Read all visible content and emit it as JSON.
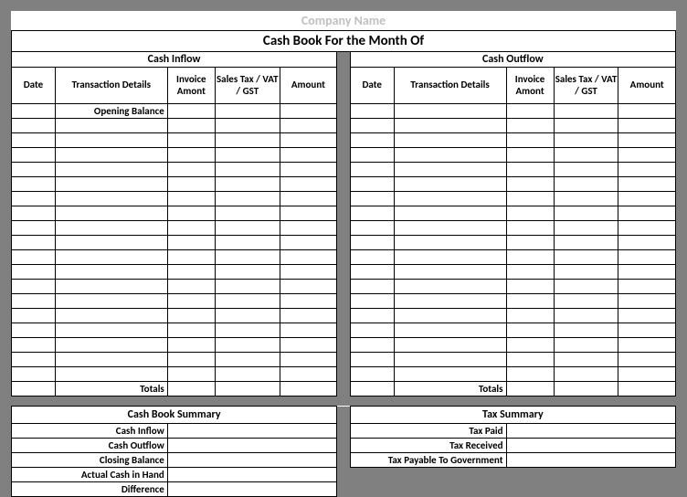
{
  "company": "Company Name",
  "title": "Cash Book For the Month Of",
  "inflow": {
    "header": "Cash Inflow",
    "cols": [
      "Date",
      "Transaction Details",
      "Invoice Amont",
      "Sales Tax / VAT / GST",
      "Amount"
    ],
    "opening": "Opening Balance",
    "totals": "Totals"
  },
  "outflow": {
    "header": "Cash Outflow",
    "cols": [
      "Date",
      "Transaction Details",
      "Invoice Amont",
      "Sales Tax / VAT / GST",
      "Amount"
    ],
    "totals": "Totals"
  },
  "cashSummary": {
    "header": "Cash Book Summary",
    "rows": [
      "Cash Inflow",
      "Cash Outflow",
      "Closing Balance",
      "Actual Cash in Hand",
      "Difference"
    ]
  },
  "taxSummary": {
    "header": "Tax Summary",
    "rows": [
      "Tax Paid",
      "Tax Received",
      "Tax Payable To Government"
    ]
  }
}
